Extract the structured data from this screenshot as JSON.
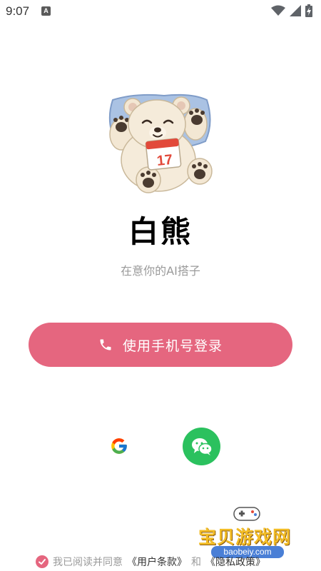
{
  "status_bar": {
    "time": "9:07",
    "badge": "A",
    "icons": [
      "notification-a-icon",
      "wifi-icon",
      "signal-icon",
      "battery-charging-icon"
    ]
  },
  "app": {
    "title": "白熊",
    "tagline": "在意你的AI搭子",
    "mascot_icon": "polar-bear-mascot-icon",
    "calendar_day": "17"
  },
  "login": {
    "phone_button_label": "使用手机号登录",
    "phone_icon": "phone-icon"
  },
  "social_login": {
    "google_icon": "google-icon",
    "wechat_icon": "wechat-icon"
  },
  "agreement": {
    "prefix": "我已阅读并同意",
    "terms_link": "《用户条款》",
    "conjunction": "和",
    "privacy_link": "《隐私政策》"
  },
  "watermark": {
    "text": "宝贝游戏网",
    "url": "baobeiy.com"
  },
  "colors": {
    "accent": "#e5667f",
    "wechat_green": "#2bc15e",
    "subtle_text": "#9a9a9a"
  }
}
